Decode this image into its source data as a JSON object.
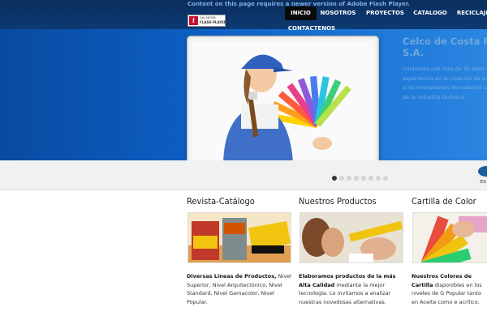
{
  "header": {
    "flash_notice": "Content on this page requires a newer version of Adobe Flash Player.",
    "flash_badge_small": "Get ADOBE",
    "flash_badge_big": "FLASH PLAYER"
  },
  "nav": {
    "items": [
      "INICIO",
      "NOSOTROS",
      "PROYECTOS",
      "CATALOGO",
      "RECICLAJE",
      "CONTACTENOS"
    ],
    "active": "INICIO"
  },
  "slider": {
    "title_line1": "Celco de Costa Ri",
    "title_line2": "S.A.",
    "desc_lines": [
      "Contamos con más de 35 años de",
      "experiencia en la creación de solu",
      "a las necesidades de nuestros clie",
      "de la industria Química."
    ],
    "dot_count": 8,
    "active_dot": 0
  },
  "corner": {
    "text": "es"
  },
  "columns": [
    {
      "title": "Revista-Catálogo",
      "text_bold": "Diversas Líneas de Productos,",
      "text_rest": " Nivel Superior, Nivel Arquitectónico, Nivel Standard, Nivel Gamacolor, Nivel Popular."
    },
    {
      "title": "Nuestros Productos",
      "text_bold": "Elaboramos productos de la más Alta Calidad",
      "text_rest": " mediante la mejor tecnología. Lo invitamos a analizar nuestras novedosas alternativas."
    },
    {
      "title": "Cartilla de Color",
      "text_bold": "Nuestros Colores de Cartilla",
      "text_rest": " disponibles en los niveles de G Popular tanto en Aceite como e acrílico."
    }
  ],
  "colors": {
    "brand_blue": "#0c5fc4",
    "nav_active": "#0a0a0a"
  }
}
